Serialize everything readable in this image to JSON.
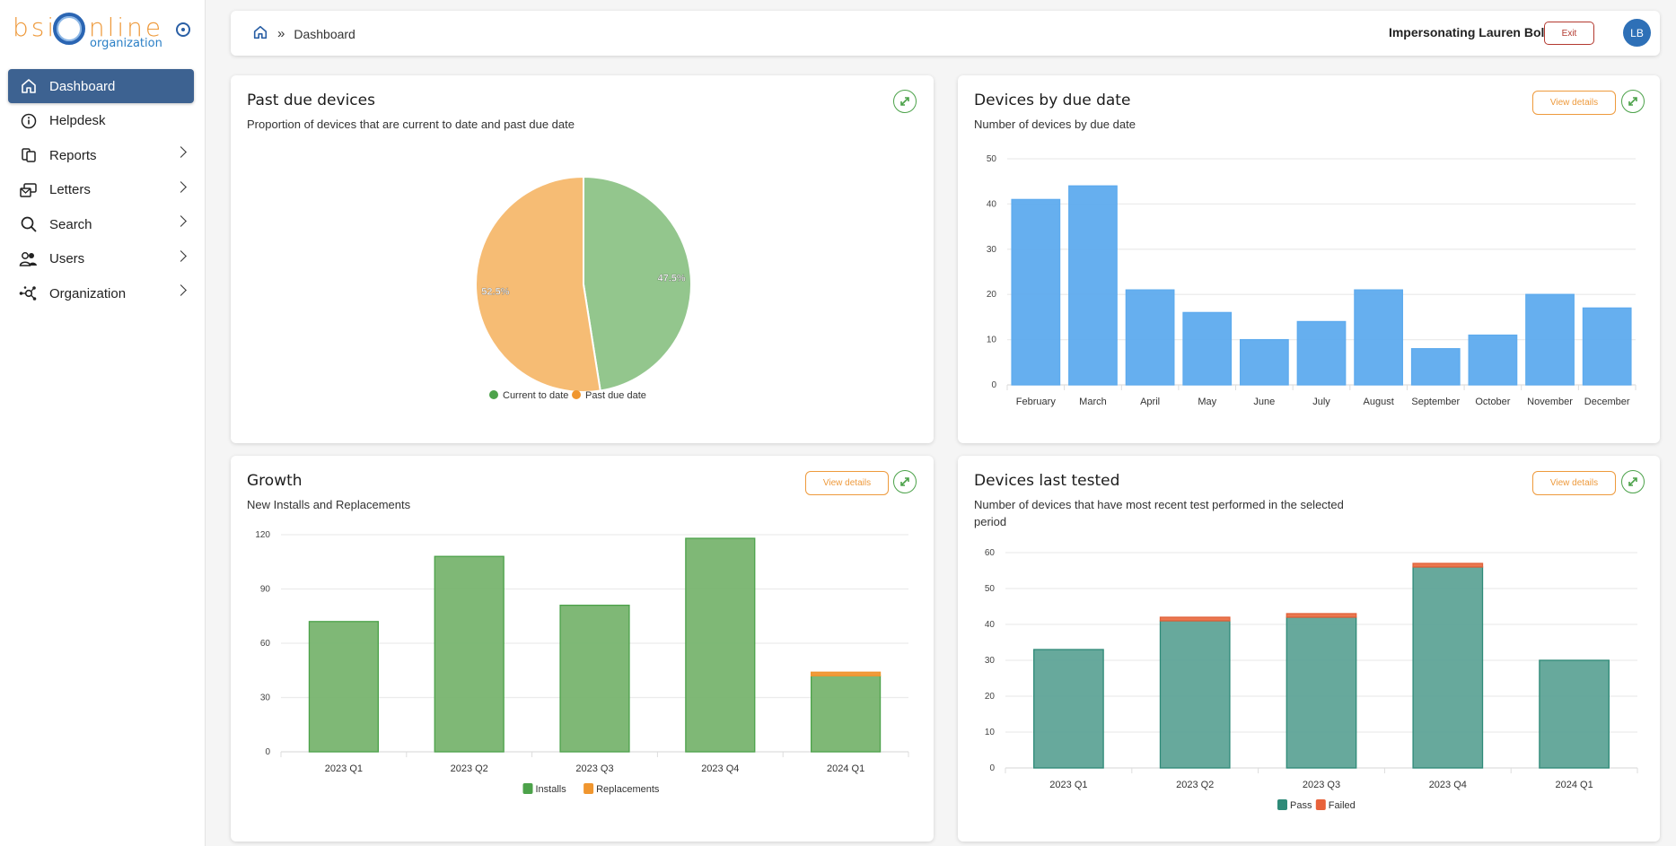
{
  "brand": {
    "name": "bsionline",
    "sub": "organization"
  },
  "sidebar": {
    "items": [
      {
        "label": "Dashboard",
        "icon": "home-icon",
        "active": true,
        "has_children": false
      },
      {
        "label": "Helpdesk",
        "icon": "info-icon",
        "active": false,
        "has_children": false
      },
      {
        "label": "Reports",
        "icon": "reports-icon",
        "active": false,
        "has_children": true
      },
      {
        "label": "Letters",
        "icon": "letters-icon",
        "active": false,
        "has_children": true
      },
      {
        "label": "Search",
        "icon": "search-icon",
        "active": false,
        "has_children": true
      },
      {
        "label": "Users",
        "icon": "users-icon",
        "active": false,
        "has_children": true
      },
      {
        "label": "Organization",
        "icon": "organization-icon",
        "active": false,
        "has_children": true
      }
    ]
  },
  "header": {
    "breadcrumb": "Dashboard",
    "impersonating": "Impersonating Lauren Bolek",
    "exit_label": "Exit",
    "avatar_initials": "LB"
  },
  "cards": {
    "past_due": {
      "title": "Past due devices",
      "subtitle": "Proportion of devices that are current to date and past due date"
    },
    "due_date": {
      "title": "Devices by due date",
      "subtitle": "Number of devices by due date",
      "view_label": "View details"
    },
    "growth": {
      "title": "Growth",
      "subtitle": "New Installs and Replacements",
      "view_label": "View details"
    },
    "last_tested": {
      "title": "Devices last tested",
      "subtitle": "Number of devices that have most recent test performed in the selected period",
      "view_label": "View details"
    }
  },
  "colors": {
    "accent": "#3d6291",
    "orange": "#ee9a3c",
    "green": "#4ca24a",
    "exit": "#b3392f"
  },
  "chart_data": [
    {
      "type": "pie",
      "title": "Past due devices",
      "labels": [
        "Current to date",
        "Past due date"
      ],
      "values": [
        47.5,
        52.5
      ],
      "value_labels": [
        "47.5%",
        "52.5%"
      ],
      "colors": [
        "#93c68d",
        "#f6bc74"
      ],
      "legend_colors": [
        "#4ca24a",
        "#f0962f"
      ],
      "legend": "bottom"
    },
    {
      "type": "bar",
      "title": "Devices by due date",
      "categories": [
        "February",
        "March",
        "April",
        "May",
        "June",
        "July",
        "August",
        "September",
        "October",
        "November",
        "December"
      ],
      "values": [
        41,
        44,
        21,
        16,
        10,
        14,
        21,
        8,
        11,
        20,
        17
      ],
      "ylim": [
        0,
        50
      ],
      "yticks": [
        0,
        10,
        20,
        30,
        40,
        50
      ],
      "grid": true,
      "color": "#5eabee"
    },
    {
      "type": "bar",
      "stacked": true,
      "title": "Growth",
      "categories": [
        "2023 Q1",
        "2023 Q2",
        "2023 Q3",
        "2023 Q4",
        "2024 Q1"
      ],
      "series": [
        {
          "name": "Installs",
          "values": [
            72,
            108,
            81,
            118,
            42
          ],
          "color": "#78b46f",
          "legend_color": "#4ca24a"
        },
        {
          "name": "Replacements",
          "values": [
            0,
            0,
            0,
            0,
            2
          ],
          "color": "#f0962f",
          "legend_color": "#f0962f"
        }
      ],
      "ylim": [
        0,
        120
      ],
      "yticks": [
        0,
        30,
        60,
        90,
        120
      ],
      "grid": true,
      "legend": "bottom"
    },
    {
      "type": "bar",
      "stacked": true,
      "title": "Devices last tested",
      "categories": [
        "2023 Q1",
        "2023 Q2",
        "2023 Q3",
        "2023 Q4",
        "2024 Q1"
      ],
      "series": [
        {
          "name": "Pass",
          "values": [
            33,
            41,
            42,
            56,
            30
          ],
          "color": "#5fa497",
          "legend_color": "#2e8a78"
        },
        {
          "name": "Failed",
          "values": [
            0,
            1,
            1,
            1,
            0
          ],
          "color": "#ea7147",
          "legend_color": "#e8623a"
        }
      ],
      "ylim": [
        0,
        60
      ],
      "yticks": [
        0,
        10,
        20,
        30,
        40,
        50,
        60
      ],
      "grid": true,
      "legend": "bottom"
    }
  ]
}
